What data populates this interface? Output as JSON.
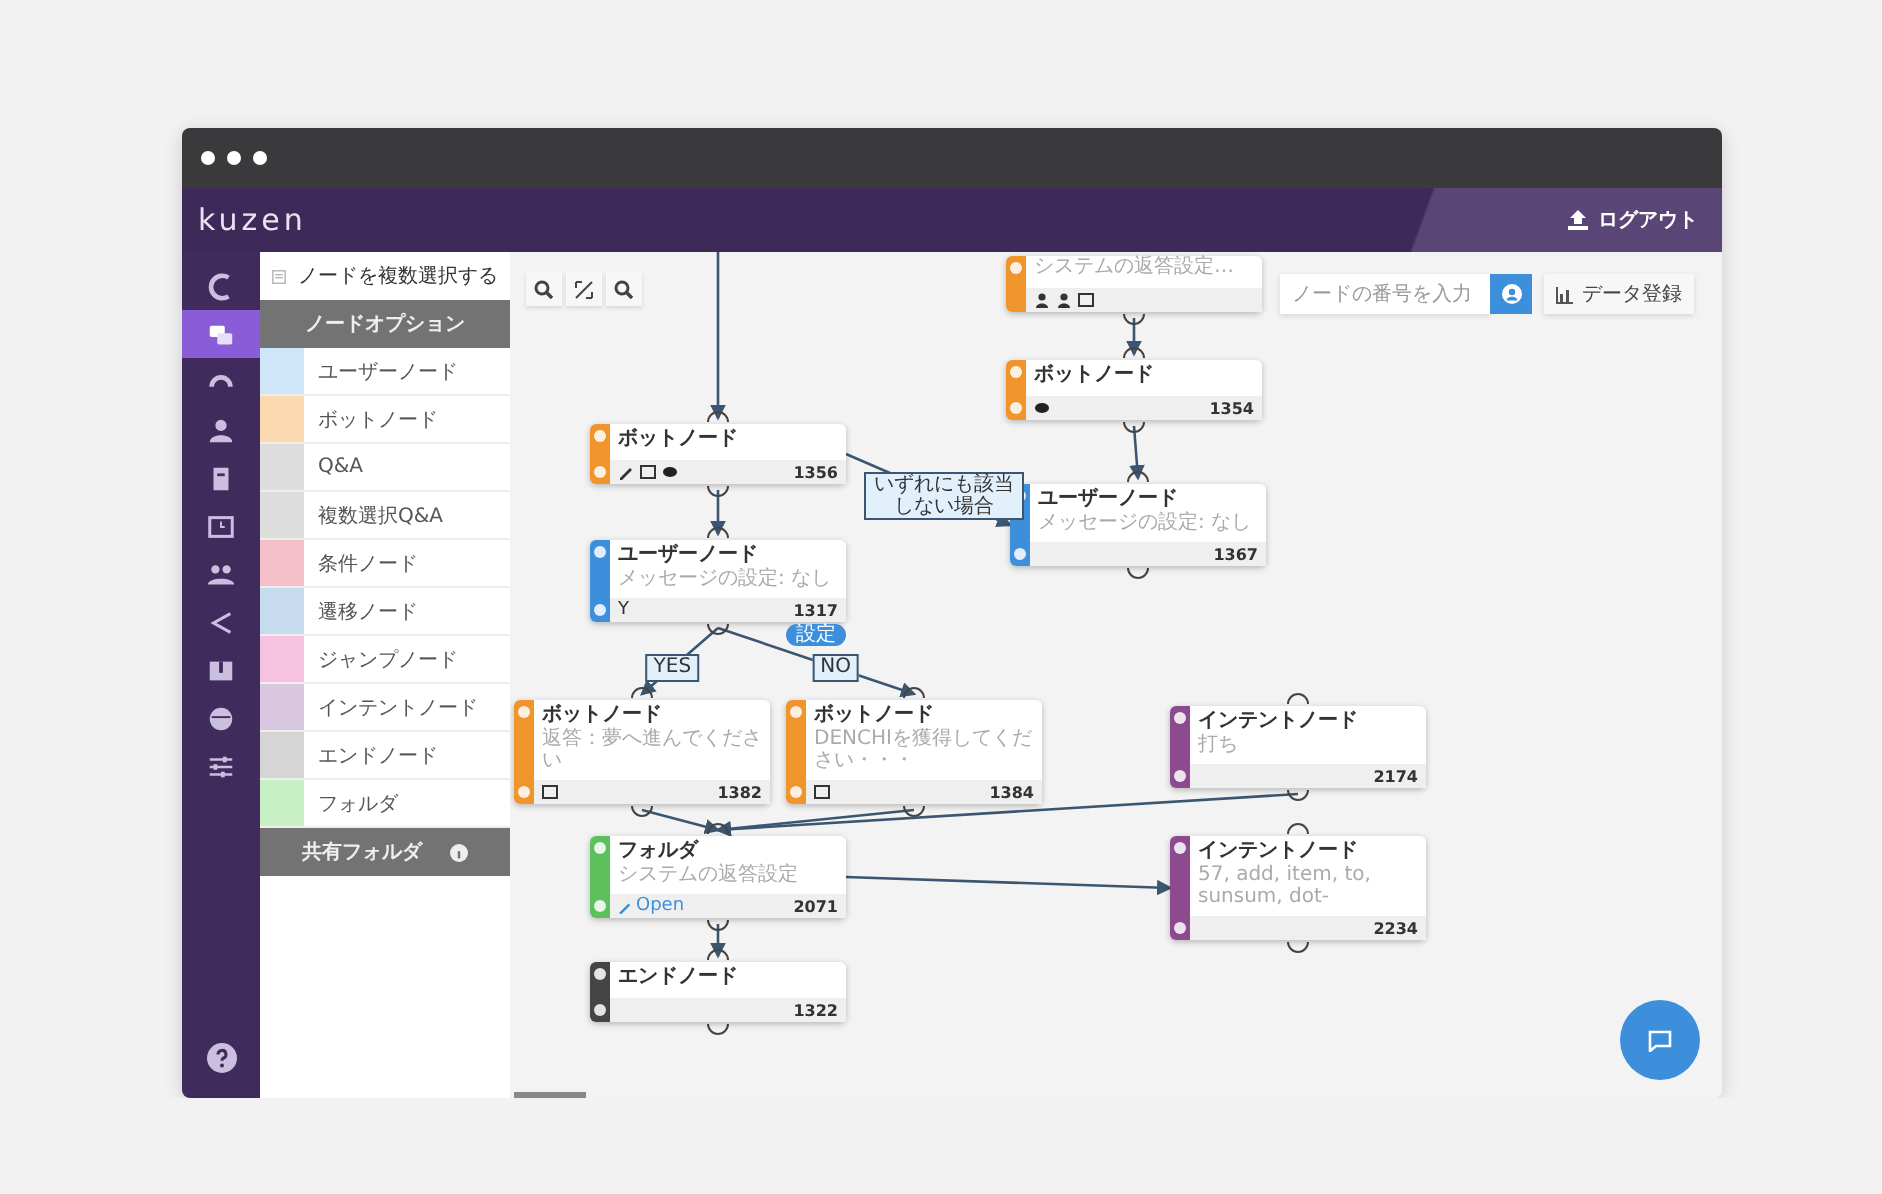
{
  "header": {
    "logo": "kuzen",
    "logout": "ログアウト"
  },
  "rail": {
    "items": [
      {
        "selected": false
      },
      {
        "selected": true
      },
      {
        "selected": false
      },
      {
        "selected": false
      },
      {
        "selected": false
      },
      {
        "selected": false
      },
      {
        "selected": false
      },
      {
        "selected": false
      },
      {
        "selected": false
      },
      {
        "selected": false
      },
      {
        "selected": false
      }
    ]
  },
  "menu": {
    "multi_select": "ノードを複数選択する",
    "options_header": "ノードオプション",
    "items": [
      {
        "label": "ユーザーノード",
        "color": "#cfe6f8"
      },
      {
        "label": "ボットノード",
        "color": "#fbd9b0"
      },
      {
        "label": "Q&A",
        "color": "#dddddd"
      },
      {
        "label": "複数選択Q&A",
        "color": "#dddddd"
      },
      {
        "label": "条件ノード",
        "color": "#f6c0cb"
      },
      {
        "label": "遷移ノード",
        "color": "#c6dcee"
      },
      {
        "label": "ジャンプノード",
        "color": "#f5c3e0"
      },
      {
        "label": "インテントノード",
        "color": "#d9c6e0"
      },
      {
        "label": "エンドノード",
        "color": "#d5d5d5"
      },
      {
        "label": "フォルダ",
        "color": "#c9efc4"
      }
    ],
    "shared_folder": "共有フォルダ"
  },
  "canvas": {
    "search": {
      "placeholder": "ノードの番号を入力"
    },
    "data_button": "データ登録",
    "nodes": [
      {
        "kind": "bot",
        "subtitle": "システムの返答設定…"
      },
      {
        "kind": "bot",
        "title": "ボットノード",
        "id": "1356"
      },
      {
        "kind": "bot",
        "title": "ボットノード",
        "id": "1354"
      },
      {
        "kind": "user",
        "title": "ユーザーノード",
        "subtitle": "メッセージの設定: なし",
        "id": "1367"
      },
      {
        "kind": "user",
        "title": "ユーザーノード",
        "subtitle": "メッセージの設定: なし",
        "footer_text": "Y",
        "badge": "設定",
        "id": "1317"
      },
      {
        "kind": "bot",
        "title": "ボットノード",
        "subtitle": "返答：夢へ進んでください",
        "id": "1382"
      },
      {
        "kind": "bot",
        "title": "ボットノード",
        "subtitle": "DENCHIを獲得してください・・・",
        "id": "1384"
      },
      {
        "kind": "intent",
        "title": "インテントノード",
        "subtitle": "打ち",
        "id": "2174"
      },
      {
        "kind": "folder",
        "title": "フォルダ",
        "subtitle": "システムの返答設定",
        "link": "Open",
        "id": "2071"
      },
      {
        "kind": "intent",
        "title": "インテントノード",
        "subtitle": "57, add, item, to, sunsum, dot-",
        "id": "2234"
      },
      {
        "kind": "end",
        "title": "エンドノード",
        "id": "1322"
      }
    ],
    "edge_labels": [
      "YES",
      "NO",
      "いずれにも該当しない場合"
    ]
  }
}
